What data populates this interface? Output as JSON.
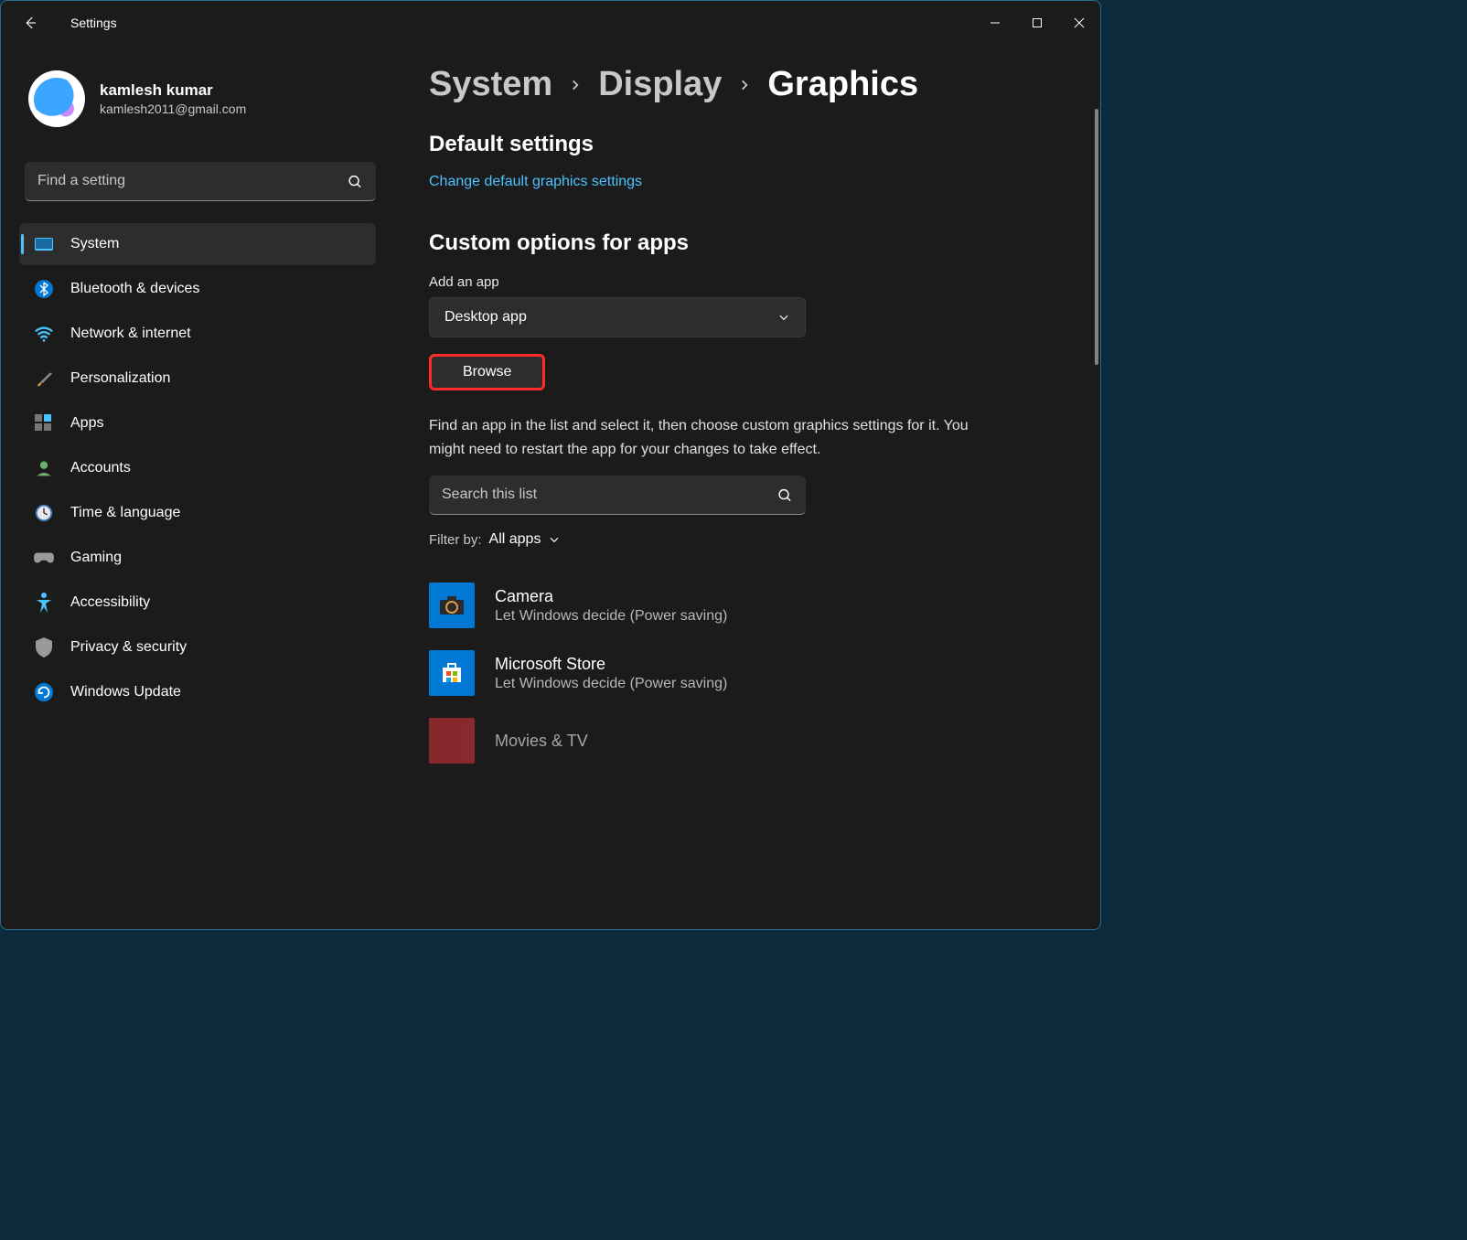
{
  "app": {
    "title": "Settings"
  },
  "user": {
    "name": "kamlesh kumar",
    "email": "kamlesh2011@gmail.com"
  },
  "search": {
    "placeholder": "Find a setting"
  },
  "sidebar": {
    "items": [
      {
        "label": "System",
        "icon": "display"
      },
      {
        "label": "Bluetooth & devices",
        "icon": "bluetooth"
      },
      {
        "label": "Network & internet",
        "icon": "wifi"
      },
      {
        "label": "Personalization",
        "icon": "brush"
      },
      {
        "label": "Apps",
        "icon": "apps"
      },
      {
        "label": "Accounts",
        "icon": "account"
      },
      {
        "label": "Time & language",
        "icon": "clock"
      },
      {
        "label": "Gaming",
        "icon": "gamepad"
      },
      {
        "label": "Accessibility",
        "icon": "accessibility"
      },
      {
        "label": "Privacy & security",
        "icon": "shield"
      },
      {
        "label": "Windows Update",
        "icon": "update"
      }
    ]
  },
  "breadcrumb": {
    "l1": "System",
    "l2": "Display",
    "l3": "Graphics"
  },
  "main": {
    "default_title": "Default settings",
    "change_link": "Change default graphics settings",
    "custom_title": "Custom options for apps",
    "add_label": "Add an app",
    "dropdown_value": "Desktop app",
    "browse": "Browse",
    "help": "Find an app in the list and select it, then choose custom graphics settings for it. You might need to restart the app for your changes to take effect.",
    "search_list_placeholder": "Search this list",
    "filter_label": "Filter by:",
    "filter_value": "All apps",
    "apps": [
      {
        "name": "Camera",
        "sub": "Let Windows decide (Power saving)"
      },
      {
        "name": "Microsoft Store",
        "sub": "Let Windows decide (Power saving)"
      },
      {
        "name": "Movies & TV",
        "sub": ""
      }
    ]
  }
}
